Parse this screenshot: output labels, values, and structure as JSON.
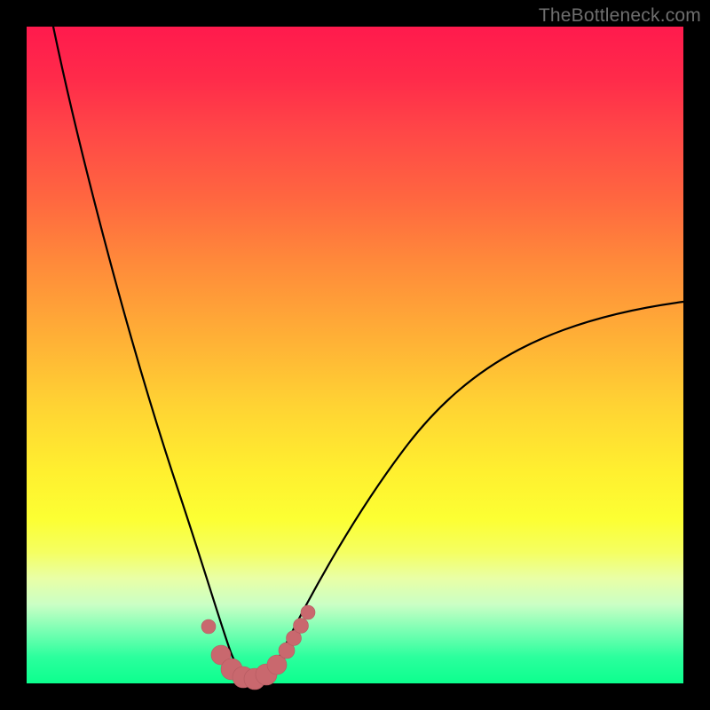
{
  "watermark": "TheBottleneck.com",
  "colors": {
    "frame": "#000000",
    "curve_stroke": "#000000",
    "marker_fill": "#c9686e",
    "marker_stroke": "#b45a60"
  },
  "chart_data": {
    "type": "line",
    "title": "",
    "xlabel": "",
    "ylabel": "",
    "xlim": [
      0,
      100
    ],
    "ylim": [
      0,
      100
    ],
    "grid": false,
    "series": [
      {
        "name": "left-branch",
        "x": [
          4,
          8,
          12,
          16,
          20,
          24,
          26,
          28,
          30,
          32
        ],
        "y": [
          100,
          78,
          58,
          40,
          24,
          10,
          5,
          2,
          0.5,
          0
        ]
      },
      {
        "name": "right-branch",
        "x": [
          36,
          40,
          44,
          50,
          56,
          64,
          72,
          80,
          90,
          100
        ],
        "y": [
          0,
          3,
          8,
          16,
          24,
          34,
          42,
          48,
          54,
          58
        ]
      }
    ],
    "markers": {
      "name": "highlighted-points",
      "points": [
        {
          "x": 27.5,
          "y": 8.5,
          "r": 1.1
        },
        {
          "x": 29.5,
          "y": 4.0,
          "r": 1.5
        },
        {
          "x": 31.0,
          "y": 1.8,
          "r": 1.7
        },
        {
          "x": 32.5,
          "y": 0.8,
          "r": 1.7
        },
        {
          "x": 34.0,
          "y": 0.4,
          "r": 1.7
        },
        {
          "x": 35.5,
          "y": 0.6,
          "r": 1.7
        },
        {
          "x": 37.0,
          "y": 1.4,
          "r": 1.6
        },
        {
          "x": 38.5,
          "y": 3.0,
          "r": 1.3
        },
        {
          "x": 39.5,
          "y": 4.8,
          "r": 1.2
        },
        {
          "x": 40.5,
          "y": 6.8,
          "r": 1.2
        },
        {
          "x": 41.5,
          "y": 9.0,
          "r": 1.1
        }
      ]
    }
  }
}
